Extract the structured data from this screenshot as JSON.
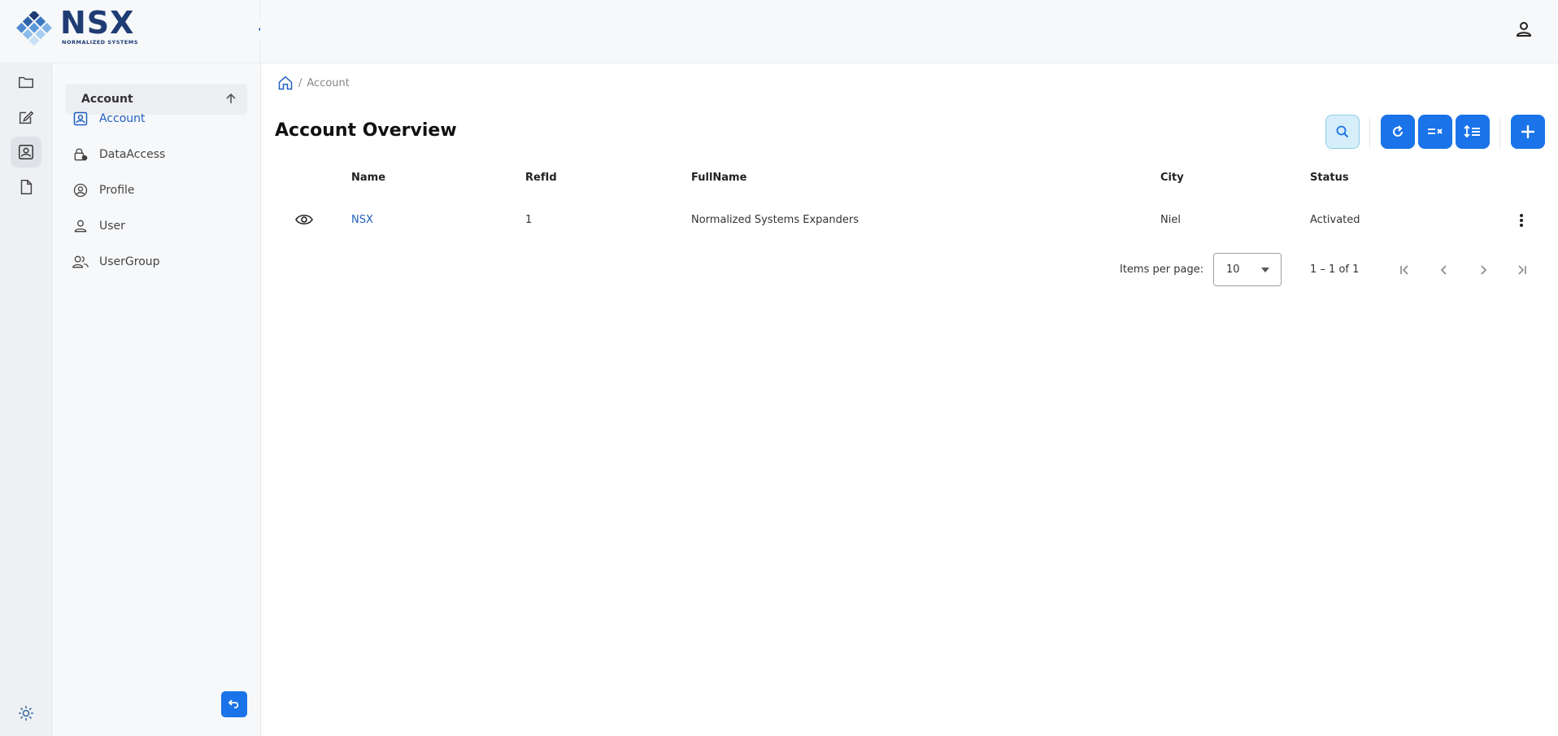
{
  "brand": {
    "name": "NSX",
    "tagline": "NORMALIZED SYSTEMS"
  },
  "sidebar": {
    "section_title": "Account",
    "items": [
      {
        "label": "Account",
        "icon": "account-box-icon",
        "active": true
      },
      {
        "label": "DataAccess",
        "icon": "lock-person-icon",
        "active": false
      },
      {
        "label": "Profile",
        "icon": "profile-circle-icon",
        "active": false
      },
      {
        "label": "User",
        "icon": "user-icon",
        "active": false
      },
      {
        "label": "UserGroup",
        "icon": "user-group-icon",
        "active": false
      }
    ]
  },
  "rail": {
    "items": [
      "folder-icon",
      "edit-icon",
      "account-box-icon",
      "document-icon"
    ],
    "active_index": 2
  },
  "breadcrumb": {
    "home_icon": "home-icon",
    "separator": "/",
    "current": "Account"
  },
  "page": {
    "title": "Account Overview"
  },
  "toolbar": {
    "buttons": [
      "search-icon",
      "refresh-icon",
      "filter-clear-icon",
      "sort-icon",
      "add-icon"
    ]
  },
  "table": {
    "columns": [
      "Name",
      "RefId",
      "FullName",
      "City",
      "Status"
    ],
    "rows": [
      {
        "name": "NSX",
        "refid": "1",
        "fullname": "Normalized Systems Expanders",
        "city": "Niel",
        "status": "Activated"
      }
    ]
  },
  "paginator": {
    "items_per_page_label": "Items per page:",
    "items_per_page": "10",
    "range": "1 – 1 of 1"
  },
  "colors": {
    "primary": "#1a73e8",
    "brand": "#1f3c74",
    "link": "#1f5fbf"
  }
}
